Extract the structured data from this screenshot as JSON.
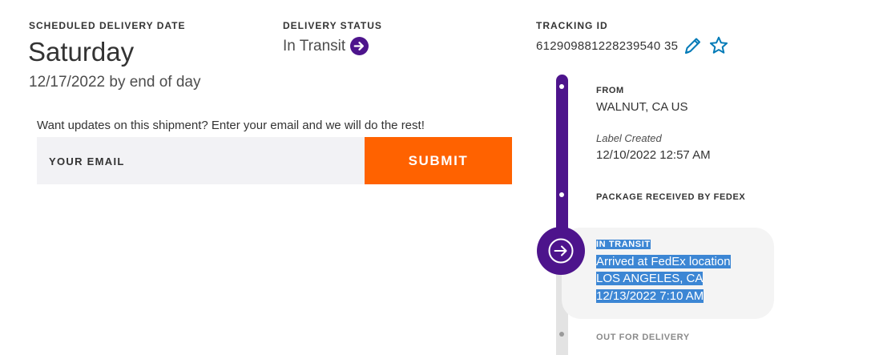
{
  "delivery": {
    "date_label": "SCHEDULED DELIVERY DATE",
    "day": "Saturday",
    "date_line": "12/17/2022 by end of day"
  },
  "status": {
    "label": "DELIVERY STATUS",
    "value": "In Transit"
  },
  "tracking": {
    "label": "TRACKING ID",
    "number": "612909881228239540 35"
  },
  "updates": {
    "prompt": "Want updates on this shipment? Enter your email and we will do the rest!",
    "email_placeholder": "YOUR EMAIL",
    "submit_label": "SUBMIT"
  },
  "timeline": {
    "from_label": "FROM",
    "from_value": "WALNUT, CA US",
    "created_label": "Label Created",
    "created_value": "12/10/2022 12:57 AM",
    "received_label": "PACKAGE RECEIVED BY FEDEX",
    "current": {
      "label": "IN TRANSIT",
      "line1": "Arrived at FedEx location",
      "line2": "LOS ANGELES, CA",
      "line3": "12/13/2022 7:10 AM"
    },
    "next_label": "OUT FOR DELIVERY"
  },
  "colors": {
    "brand_purple": "#4d148c",
    "brand_orange": "#ff6200",
    "accent_blue": "#007ab7",
    "selection": "#3c86d4"
  },
  "icons": {
    "status": "arrow-right-circle-icon",
    "edit": "pencil-icon",
    "favorite": "star-icon",
    "timeline_current": "arrow-right-circle-icon"
  }
}
